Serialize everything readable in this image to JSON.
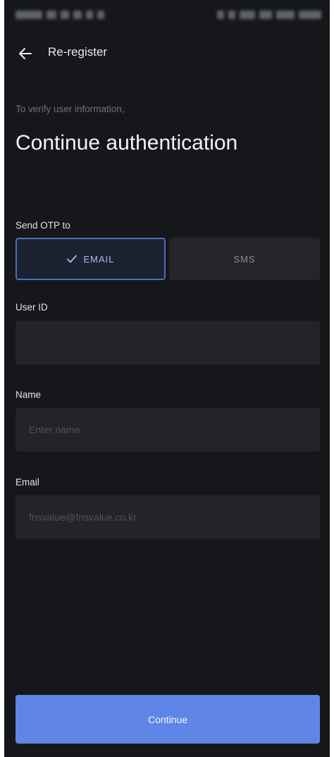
{
  "header": {
    "title": "Re-register",
    "back_icon": "arrow-left-icon"
  },
  "intro": {
    "subtitle": "To verify user information,",
    "heading": "Continue authentication"
  },
  "otp": {
    "label": "Send OTP to",
    "options": [
      {
        "label": "EMAIL",
        "selected": true,
        "icon": "check-icon"
      },
      {
        "label": "SMS",
        "selected": false
      }
    ]
  },
  "form": {
    "user_id": {
      "label": "User ID",
      "value": "",
      "placeholder": ""
    },
    "name": {
      "label": "Name",
      "value": "",
      "placeholder": "Enter name"
    },
    "email": {
      "label": "Email",
      "value": "fnsvalue@fnsvalue.co.kr"
    }
  },
  "actions": {
    "continue_label": "Continue"
  },
  "colors": {
    "background": "#16171b",
    "field_background": "#222429",
    "accent": "#5f86e6",
    "selected_border": "#4e6fbf"
  }
}
